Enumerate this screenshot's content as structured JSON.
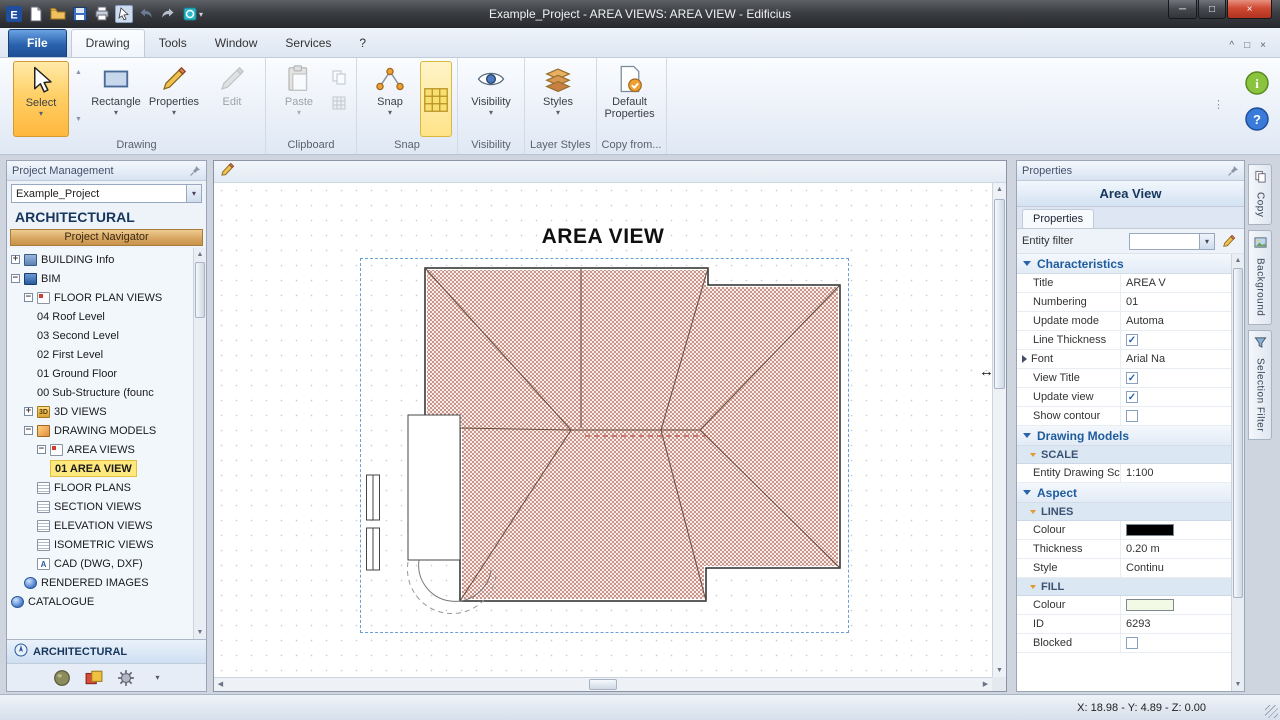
{
  "window": {
    "title": "Example_Project - AREA VIEWS: AREA VIEW - Edificius"
  },
  "quick_access": [
    "edificius-logo",
    "new-document",
    "open-folder",
    "save",
    "print",
    "pointer-tool",
    "undo",
    "redo",
    "zoom-tool"
  ],
  "menu": {
    "items": [
      {
        "label": "File",
        "type": "file"
      },
      {
        "label": "Drawing",
        "active": true
      },
      {
        "label": "Tools"
      },
      {
        "label": "Window"
      },
      {
        "label": "Services"
      },
      {
        "label": "?"
      }
    ],
    "right_icons": [
      "collapse-ribbon",
      "restore-window",
      "close-window"
    ]
  },
  "ribbon": {
    "groups": [
      {
        "label": "Drawing",
        "buttons": [
          {
            "label": "Select",
            "icon": "cursor",
            "selected": true,
            "caret": true,
            "gallery": true
          },
          {
            "label": "Rectangle",
            "icon": "rectangle",
            "caret": true
          },
          {
            "label": "Properties",
            "icon": "properties",
            "caret": true
          },
          {
            "label": "Edit",
            "icon": "edit",
            "disabled": true
          }
        ]
      },
      {
        "label": "Clipboard",
        "buttons": [
          {
            "label": "Paste",
            "icon": "paste",
            "caret": true,
            "disabled": true
          }
        ],
        "small_buttons": [
          "copy-small",
          "grid-small"
        ]
      },
      {
        "label": "Snap",
        "buttons": [
          {
            "label": "Snap",
            "icon": "snap",
            "caret": true
          },
          {
            "label": "",
            "icon": "grid-toggle",
            "toggle": true
          }
        ]
      },
      {
        "label": "Visibility",
        "buttons": [
          {
            "label": "Visibility",
            "icon": "visibility",
            "caret": true
          }
        ]
      },
      {
        "label": "Layer Styles",
        "buttons": [
          {
            "label": "Styles",
            "icon": "styles",
            "caret": true
          }
        ]
      },
      {
        "label": "Copy from...",
        "buttons": [
          {
            "label": "Default Properties",
            "icon": "default-properties"
          }
        ]
      }
    ],
    "help_icons": [
      "info-circle",
      "help-circle"
    ]
  },
  "project_panel": {
    "header": "Project Management",
    "project_name": "Example_Project",
    "section_title": "ARCHITECTURAL",
    "navigator_button": "Project Navigator",
    "tree": [
      {
        "label": "BUILDING Info",
        "indent": 0,
        "expander": "plus",
        "icon": "building"
      },
      {
        "label": "BIM",
        "indent": 0,
        "expander": "minus",
        "icon": "bim"
      },
      {
        "label": "FLOOR PLAN VIEWS",
        "indent": 1,
        "expander": "minus",
        "icon": "doc"
      },
      {
        "label": "04 Roof Level",
        "indent": 2
      },
      {
        "label": "03 Second Level",
        "indent": 2
      },
      {
        "label": "02 First Level",
        "indent": 2
      },
      {
        "label": "01 Ground Floor",
        "indent": 2
      },
      {
        "label": "00 Sub-Structure (founc",
        "indent": 2
      },
      {
        "label": "3D VIEWS",
        "indent": 1,
        "expander": "plus",
        "icon": "threed"
      },
      {
        "label": "DRAWING MODELS",
        "indent": 1,
        "expander": "minus",
        "icon": "pencil"
      },
      {
        "label": "AREA VIEWS",
        "indent": 2,
        "expander": "minus",
        "icon": "doc"
      },
      {
        "label": "01 AREA VIEW",
        "indent": 3,
        "selected": true
      },
      {
        "label": "FLOOR PLANS",
        "indent": 2,
        "icon": "sheet"
      },
      {
        "label": "SECTION VIEWS",
        "indent": 2,
        "icon": "sheet"
      },
      {
        "label": "ELEVATION VIEWS",
        "indent": 2,
        "icon": "sheet"
      },
      {
        "label": "ISOMETRIC VIEWS",
        "indent": 2,
        "icon": "sheet"
      },
      {
        "label": "CAD (DWG, DXF)",
        "indent": 2,
        "icon": "cad"
      },
      {
        "label": "RENDERED IMAGES",
        "indent": 1,
        "icon": "sphere"
      },
      {
        "label": "CATALOGUE",
        "indent": 0,
        "icon": "sphere"
      }
    ],
    "bottom_tab": "ARCHITECTURAL",
    "bottom_icons": [
      "material-tool",
      "palette-tool",
      "settings-tool"
    ]
  },
  "canvas": {
    "view_title": "AREA VIEW"
  },
  "properties_panel": {
    "header": "Properties",
    "title": "Area View",
    "tab": "Properties",
    "entity_filter_label": "Entity filter",
    "sections": [
      {
        "title": "Characteristics",
        "rows": [
          {
            "label": "Title",
            "value": "AREA V"
          },
          {
            "label": "Numbering",
            "value": "01"
          },
          {
            "label": "Update mode",
            "value": "Automa"
          },
          {
            "label": "Line Thickness",
            "check": true
          },
          {
            "label": "Font",
            "value": "Arial Na",
            "expandable": true
          },
          {
            "label": "View Title",
            "check": true
          },
          {
            "label": "Update view",
            "check": true
          },
          {
            "label": "Show contour",
            "check": false
          }
        ]
      },
      {
        "title": "Drawing Models",
        "rows": [
          {
            "sub": "SCALE"
          },
          {
            "label": "Entity Drawing Sca",
            "value": "1:100"
          }
        ]
      },
      {
        "title": "Aspect",
        "rows": [
          {
            "sub": "LINES"
          },
          {
            "label": "Colour",
            "color": "#000000"
          },
          {
            "label": "Thickness",
            "value": "0.20 m"
          },
          {
            "label": "Style",
            "value": "Continu"
          },
          {
            "sub": "FILL"
          },
          {
            "label": "Colour",
            "color": "#f2fae6"
          },
          {
            "label": "ID",
            "value": "6293"
          },
          {
            "label": "Blocked",
            "check": false
          }
        ]
      }
    ]
  },
  "side_tabs": [
    {
      "label": "Copy",
      "icon": "copy"
    },
    {
      "label": "Background",
      "icon": "background"
    },
    {
      "label": "Selection Filter",
      "icon": "selection-filter"
    }
  ],
  "status_bar": {
    "coordinates": "X: 18.98 - Y: 4.89 - Z: 0.00"
  }
}
